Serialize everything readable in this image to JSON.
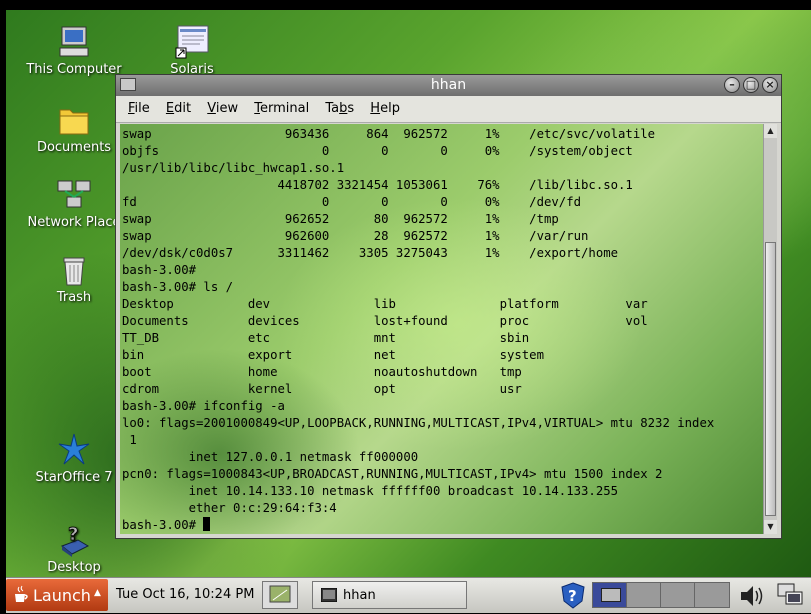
{
  "desktop": {
    "icons": [
      {
        "label": "This Computer",
        "icon": "computer-icon"
      },
      {
        "label": "Solaris",
        "icon": "solaris-doc-icon"
      },
      {
        "label": "Documents",
        "icon": "folder-icon"
      },
      {
        "label": "Network Place",
        "icon": "network-icon"
      },
      {
        "label": "Trash",
        "icon": "trash-icon"
      },
      {
        "label": "StarOffice 7",
        "icon": "staroffice-icon"
      },
      {
        "label": "Desktop",
        "icon": "desktop-help-icon"
      }
    ]
  },
  "terminal": {
    "title": "hhan",
    "menu": [
      "File",
      "Edit",
      "View",
      "Terminal",
      "Tabs",
      "Help"
    ],
    "menu_mnemonics": [
      "F",
      "E",
      "V",
      "T",
      "b",
      "H"
    ],
    "lines": [
      "swap                  963436     864  962572     1%    /etc/svc/volatile",
      "objfs                      0       0       0     0%    /system/object",
      "/usr/lib/libc/libc_hwcap1.so.1",
      "                     4418702 3321454 1053061    76%    /lib/libc.so.1",
      "fd                         0       0       0     0%    /dev/fd",
      "swap                  962652      80  962572     1%    /tmp",
      "swap                  962600      28  962572     1%    /var/run",
      "/dev/dsk/c0d0s7      3311462    3305 3275043     1%    /export/home",
      "bash-3.00#",
      "bash-3.00# ls /",
      "Desktop          dev              lib              platform         var",
      "Documents        devices          lost+found       proc             vol",
      "TT_DB            etc              mnt              sbin",
      "bin              export           net              system",
      "boot             home             noautoshutdown   tmp",
      "cdrom            kernel           opt              usr",
      "bash-3.00# ifconfig -a",
      "lo0: flags=2001000849<UP,LOOPBACK,RUNNING,MULTICAST,IPv4,VIRTUAL> mtu 8232 index",
      " 1",
      "         inet 127.0.0.1 netmask ff000000",
      "pcn0: flags=1000843<UP,BROADCAST,RUNNING,MULTICAST,IPv4> mtu 1500 index 2",
      "         inet 10.14.133.10 netmask ffffff00 broadcast 10.14.133.255",
      "         ether 0:c:29:64:f3:4"
    ],
    "prompt": "bash-3.00# "
  },
  "panel": {
    "launch_label": "Launch",
    "clock": "Tue Oct 16, 10:24 PM",
    "task_label": "hhan"
  },
  "colors": {
    "launch": "#d4542a",
    "titlebar": "#7c7c7c"
  }
}
